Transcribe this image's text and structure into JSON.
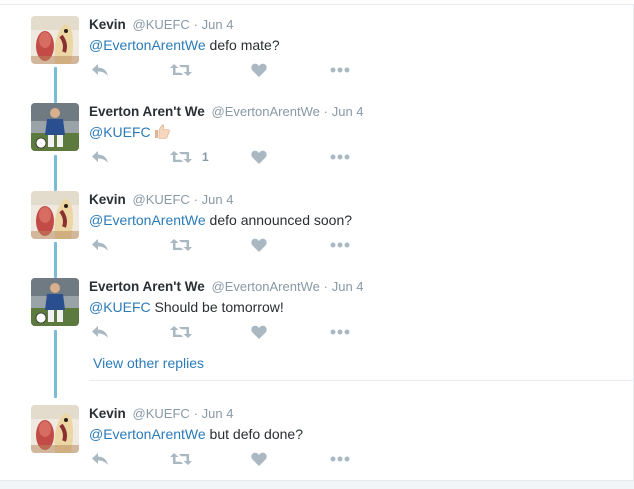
{
  "tweets": [
    {
      "author": "Kevin",
      "handle": "@KUEFC",
      "separator": "·",
      "date": "Jun 4",
      "avatar": "chicken-photo",
      "mention": "@EvertonArentWe",
      "text": " defo mate?",
      "retweet_count": ""
    },
    {
      "author": "Everton Aren't We",
      "handle": "@EvertonArentWe",
      "separator": "·",
      "date": "Jun 4",
      "avatar": "footballer-photo",
      "mention": "@KUEFC",
      "text": "",
      "emoji": "thumbs-up",
      "retweet_count": "1"
    },
    {
      "author": "Kevin",
      "handle": "@KUEFC",
      "separator": "·",
      "date": "Jun 4",
      "avatar": "chicken-photo",
      "mention": "@EvertonArentWe",
      "text": " defo announced soon?",
      "retweet_count": ""
    },
    {
      "author": "Everton Aren't We",
      "handle": "@EvertonArentWe",
      "separator": "·",
      "date": "Jun 4",
      "avatar": "footballer-photo",
      "mention": "@KUEFC",
      "text": " Should be tomorrow!",
      "retweet_count": ""
    },
    {
      "author": "Kevin",
      "handle": "@KUEFC",
      "separator": "·",
      "date": "Jun 4",
      "avatar": "chicken-photo",
      "mention": "@EvertonArentWe",
      "text": " but defo done?",
      "retweet_count": ""
    }
  ],
  "view_other_replies": "View other replies",
  "colors": {
    "link": "#2b7bb9",
    "action_icon": "#aab8c2",
    "thread_line": "#79bcd6",
    "muted_text": "#8899a6"
  },
  "icons": [
    "reply-icon",
    "retweet-icon",
    "like-icon",
    "more-icon",
    "thumbs-up-emoji"
  ]
}
